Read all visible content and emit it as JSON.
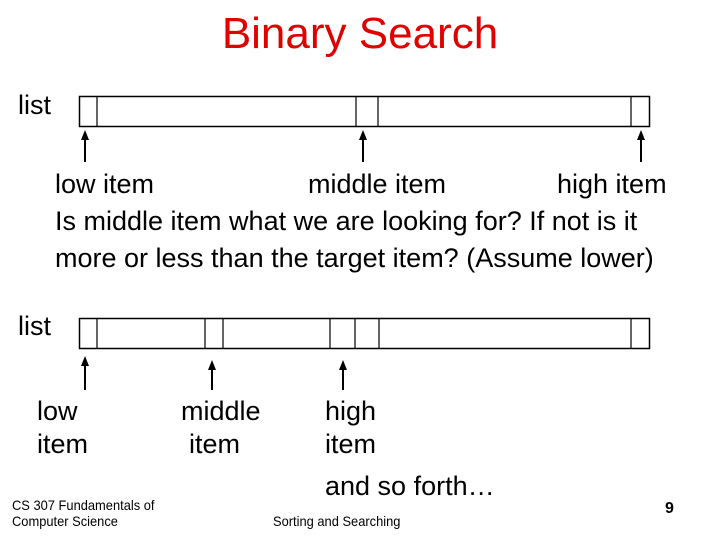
{
  "slide": {
    "title": "Binary Search",
    "title_color": "#e00000",
    "page_number": "9"
  },
  "section1": {
    "list_label": "list",
    "pointer_labels": {
      "low": "low item",
      "middle": "middle item",
      "high": "high item"
    },
    "question_line1": "Is middle item what we are looking for? If not is it",
    "question_line2": "more or less than the target item? (Assume lower)"
  },
  "section2": {
    "list_label": "list",
    "low_line1": "low",
    "low_line2": "item",
    "middle_line1": "middle",
    "middle_line2": "item",
    "high_line1": "high",
    "high_line2": "item",
    "continuation": "and so forth…"
  },
  "footer": {
    "course_line1": "CS 307 Fundamentals of",
    "course_line2": "Computer Science",
    "topic": "Sorting and Searching"
  }
}
